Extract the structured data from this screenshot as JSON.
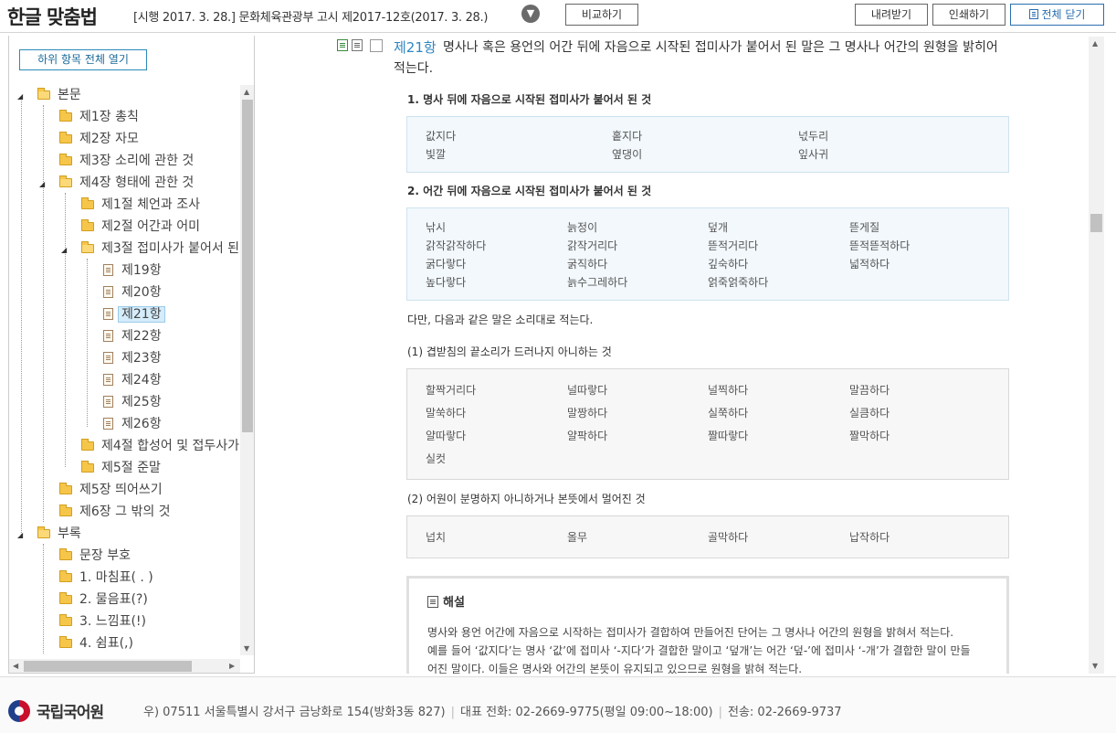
{
  "header": {
    "title": "한글 맞춤법",
    "edition": "[시행 2017. 3. 28.] 문화체육관광부 고시 제2017-12호(2017. 3. 28.)",
    "compare": "비교하기",
    "download": "내려받기",
    "print": "인쇄하기",
    "close_all": "전체 닫기"
  },
  "sidebar": {
    "expand_all": "하위 항목 전체 열기",
    "items": [
      {
        "label": "본문"
      },
      {
        "label": "제1장 총칙"
      },
      {
        "label": "제2장 자모"
      },
      {
        "label": "제3장 소리에 관한 것"
      },
      {
        "label": "제4장 형태에 관한 것"
      },
      {
        "label": "제1절 체언과 조사"
      },
      {
        "label": "제2절 어간과 어미"
      },
      {
        "label": "제3절 접미사가 붙어서 된"
      },
      {
        "label": "제19항"
      },
      {
        "label": "제20항"
      },
      {
        "label": "제21항"
      },
      {
        "label": "제22항"
      },
      {
        "label": "제23항"
      },
      {
        "label": "제24항"
      },
      {
        "label": "제25항"
      },
      {
        "label": "제26항"
      },
      {
        "label": "제4절 합성어 및 접두사가"
      },
      {
        "label": "제5절 준말"
      },
      {
        "label": "제5장 띄어쓰기"
      },
      {
        "label": "제6장 그 밖의 것"
      },
      {
        "label": "부록"
      },
      {
        "label": "문장 부호"
      },
      {
        "label": "1. 마침표( . )"
      },
      {
        "label": "2. 물음표(?)"
      },
      {
        "label": "3. 느낌표(!)"
      },
      {
        "label": "4. 쉼표(,)"
      }
    ]
  },
  "article": {
    "number": "제21항",
    "text_line1": "명사나 혹은 용언의 어간 뒤에 자음으로 시작된 접미사가 붙어서 된 말은 그 명사나 어간의 원형을 밝히어",
    "text_line2": "적는다.",
    "section1_title": "1. 명사 뒤에 자음으로 시작된 접미사가 붙어서 된 것",
    "section1_words": [
      "값지다",
      "홑지다",
      "넋두리",
      "빛깔",
      "옆댕이",
      "잎사귀"
    ],
    "section2_title": "2. 어간 뒤에 자음으로 시작된 접미사가 붙어서 된 것",
    "section2_words": [
      "낚시",
      "늙정이",
      "덮개",
      "뜯게질",
      "갉작갉작하다",
      "갉작거리다",
      "뜯적거리다",
      "뜯적뜯적하다",
      "굵다랗다",
      "굵직하다",
      "깊숙하다",
      "넓적하다",
      "높다랗다",
      "늙수그레하다",
      "얽죽얽죽하다"
    ],
    "exception_intro": "다만, 다음과 같은 말은 소리대로 적는다.",
    "sub1_title": "(1) 겹받침의 끝소리가 드러나지 아니하는 것",
    "sub1_words": [
      "할짝거리다",
      "널따랗다",
      "널찍하다",
      "말끔하다",
      "말쑥하다",
      "말짱하다",
      "실쭉하다",
      "실큼하다",
      "얄따랗다",
      "얄팍하다",
      "짤따랗다",
      "짤막하다",
      "실컷"
    ],
    "sub2_title": "(2) 어원이 분명하지 아니하거나 본뜻에서 멀어진 것",
    "sub2_words": [
      "넙치",
      "올무",
      "골막하다",
      "납작하다"
    ],
    "explain_title": "해설",
    "explain_line1": "명사와 용언 어간에 자음으로 시작하는 접미사가 결합하여 만들어진 단어는 그 명사나 어간의 원형을 밝혀서 적는다.",
    "explain_line2": "예를 들어 ‘값지다’는 명사 ‘값’에 접미사 ‘-지다’가 결합한 말이고 ‘덮개’는 어간 ‘덮-’에 접미사 ‘-개’가 결합한 말이 만들",
    "explain_line3": "어진 말이다. 이들은 명사와 어간의 본뜻이 유지되고 있으므로 원형을 밝혀 적는다."
  },
  "footer": {
    "org": "국립국어원",
    "address": "우) 07511 서울특별시 강서구 금낭화로 154(방화3동 827)",
    "phone": "대표 전화: 02-2669-9775(평일 09:00~18:00)",
    "fax": "전송: 02-2669-9737"
  }
}
